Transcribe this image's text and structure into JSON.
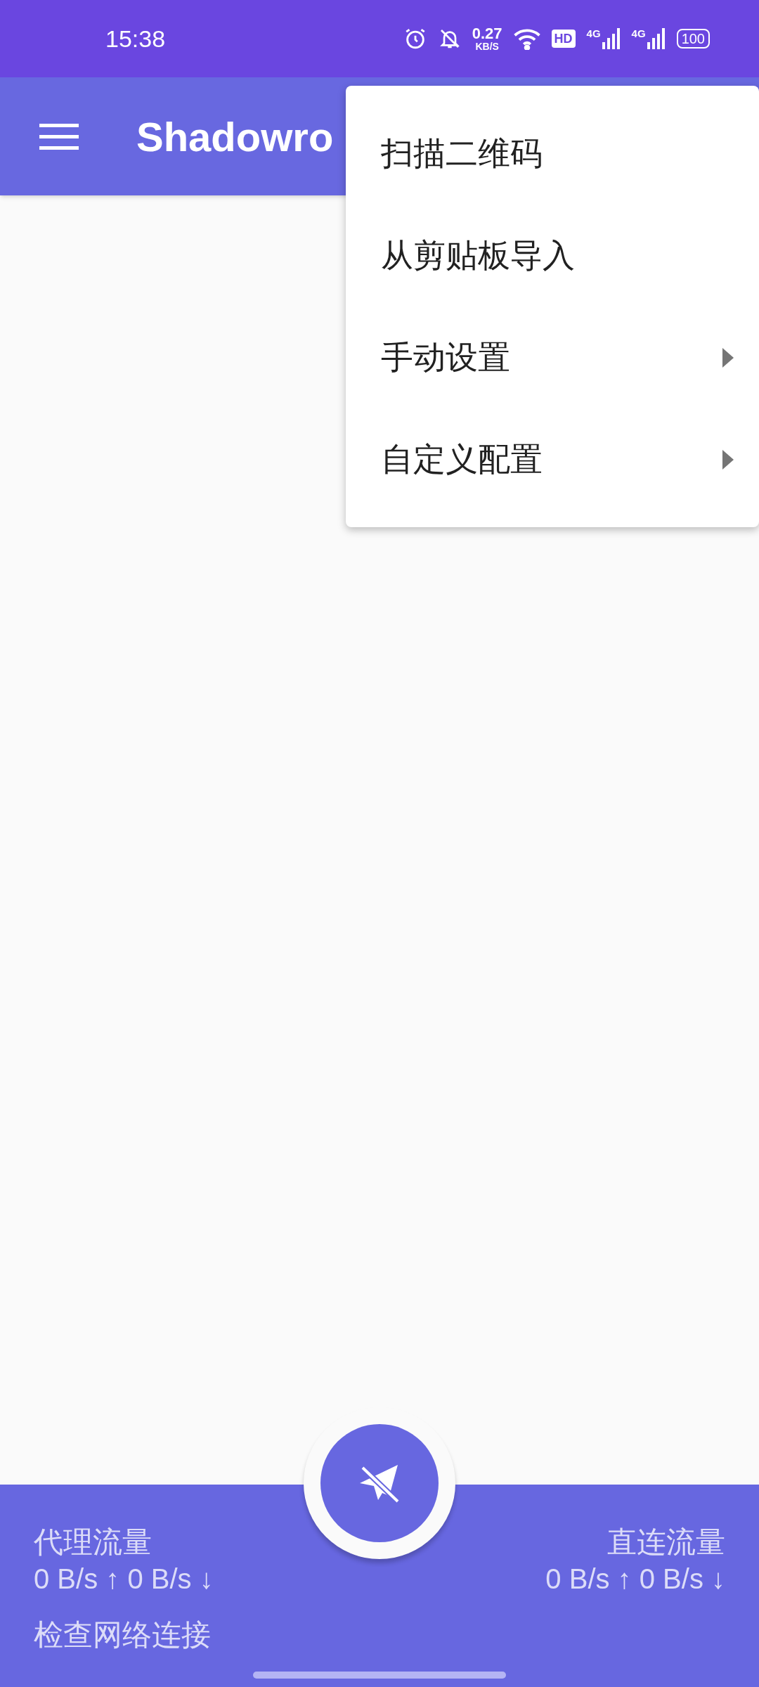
{
  "status_bar": {
    "time": "15:38",
    "net_speed": "0.27",
    "net_unit": "KB/S",
    "hd": "HD",
    "networks": [
      "4G",
      "4G"
    ],
    "battery": "100"
  },
  "toolbar": {
    "title": "Shadowro"
  },
  "menu": {
    "items": [
      {
        "label": "扫描二维码",
        "kind": "action"
      },
      {
        "label": "从剪贴板导入",
        "kind": "action"
      },
      {
        "label": "手动设置",
        "kind": "submenu"
      },
      {
        "label": "自定义配置",
        "kind": "submenu"
      }
    ]
  },
  "bottom_bar": {
    "proxy": {
      "label": "代理流量",
      "speed": "0 B/s ↑ 0 B/s ↓"
    },
    "direct": {
      "label": "直连流量",
      "speed": "0 B/s ↑ 0 B/s ↓"
    },
    "status": "检查网络连接"
  }
}
